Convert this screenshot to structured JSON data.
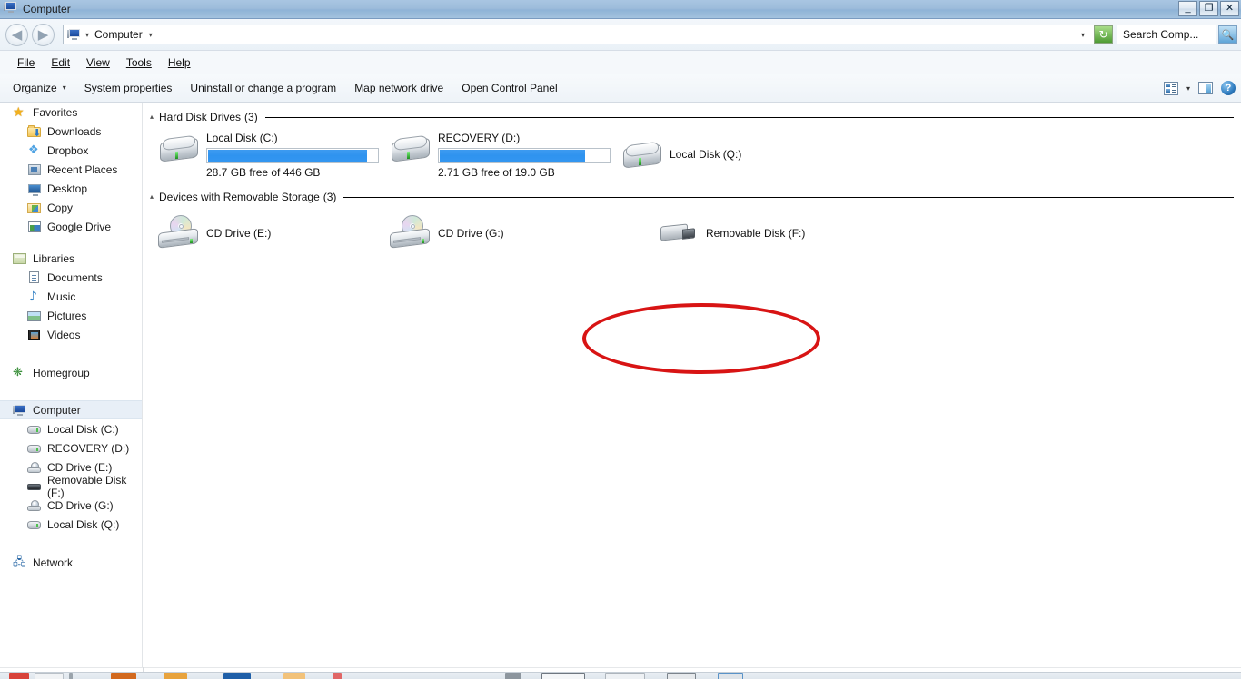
{
  "window": {
    "title": "Computer",
    "title_icon": "computer-icon",
    "minimize_label": "_",
    "maximize_label": "❐",
    "close_label": "✕"
  },
  "address_bar": {
    "back_label": "◀",
    "forward_label": "▶",
    "path_icon": "computer-icon",
    "path_caret": "▾",
    "path_text": "Computer",
    "path_trailing_caret": "▾",
    "history_dropdown": "▾",
    "refresh_label": "↻",
    "search_value": "Search Comp...",
    "search_placeholder": "Search Computer",
    "search_button_label": "🔍"
  },
  "menu": {
    "items": [
      {
        "label": "File"
      },
      {
        "label": "Edit"
      },
      {
        "label": "View"
      },
      {
        "label": "Tools"
      },
      {
        "label": "Help"
      }
    ]
  },
  "toolbar": {
    "organize_label": "Organize",
    "organize_caret": "▾",
    "items": [
      {
        "label": "System properties"
      },
      {
        "label": "Uninstall or change a program"
      },
      {
        "label": "Map network drive"
      },
      {
        "label": "Open Control Panel"
      }
    ],
    "view_caret": "▾",
    "help_label": "?"
  },
  "sidebar": {
    "groups": [
      {
        "name": "Favorites",
        "icon": "star-icon",
        "items": [
          {
            "label": "Downloads",
            "icon": "downloads-folder-icon"
          },
          {
            "label": "Dropbox",
            "icon": "dropbox-icon"
          },
          {
            "label": "Recent Places",
            "icon": "recent-places-icon"
          },
          {
            "label": "Desktop",
            "icon": "desktop-icon"
          },
          {
            "label": "Copy",
            "icon": "copy-folder-icon"
          },
          {
            "label": "Google Drive",
            "icon": "google-drive-icon"
          }
        ]
      },
      {
        "name": "Libraries",
        "icon": "libraries-icon",
        "items": [
          {
            "label": "Documents",
            "icon": "documents-icon"
          },
          {
            "label": "Music",
            "icon": "music-icon"
          },
          {
            "label": "Pictures",
            "icon": "pictures-icon"
          },
          {
            "label": "Videos",
            "icon": "videos-icon"
          }
        ]
      },
      {
        "name": "Homegroup",
        "icon": "homegroup-icon",
        "items": []
      },
      {
        "name": "Computer",
        "icon": "computer-icon",
        "selected": true,
        "items": [
          {
            "label": "Local Disk (C:)",
            "icon": "hard-disk-icon"
          },
          {
            "label": "RECOVERY (D:)",
            "icon": "hard-disk-icon"
          },
          {
            "label": "CD Drive (E:)",
            "icon": "cd-drive-icon"
          },
          {
            "label": "Removable Disk (F:)",
            "icon": "removable-disk-icon"
          },
          {
            "label": "CD Drive (G:)",
            "icon": "cd-drive-icon"
          },
          {
            "label": "Local Disk (Q:)",
            "icon": "hard-disk-icon"
          }
        ]
      },
      {
        "name": "Network",
        "icon": "network-icon",
        "items": []
      }
    ]
  },
  "content": {
    "groups": [
      {
        "caret": "▴",
        "label": "Hard Disk Drives",
        "count": "(3)",
        "drives": [
          {
            "name": "Local Disk (C:)",
            "icon": "hard-disk-icon",
            "has_progress": true,
            "used_percent": 94,
            "free_text": "28.7 GB free of 446 GB"
          },
          {
            "name": "RECOVERY (D:)",
            "icon": "hard-disk-icon",
            "has_progress": true,
            "used_percent": 86,
            "free_text": "2.71 GB free of 19.0 GB"
          },
          {
            "name": "Local Disk (Q:)",
            "icon": "hard-disk-icon",
            "has_progress": false,
            "free_text": ""
          }
        ]
      },
      {
        "caret": "▴",
        "label": "Devices with Removable Storage",
        "count": "(3)",
        "drives": [
          {
            "name": "CD Drive (E:)",
            "icon": "cd-drive-icon",
            "has_progress": false
          },
          {
            "name": "CD Drive (G:)",
            "icon": "cd-drive-icon",
            "has_progress": false
          },
          {
            "name": "Removable Disk (F:)",
            "icon": "removable-disk-icon",
            "has_progress": false,
            "annotated": true
          }
        ]
      }
    ]
  },
  "annotation": {
    "shape": "ellipse",
    "color": "#d81414",
    "target": "Removable Disk (F:)"
  },
  "colors": {
    "progress_fill": "#3396f0",
    "title_bar": "#9dbcdb",
    "selection": "#e8eff7",
    "annotation_red": "#d81414"
  }
}
